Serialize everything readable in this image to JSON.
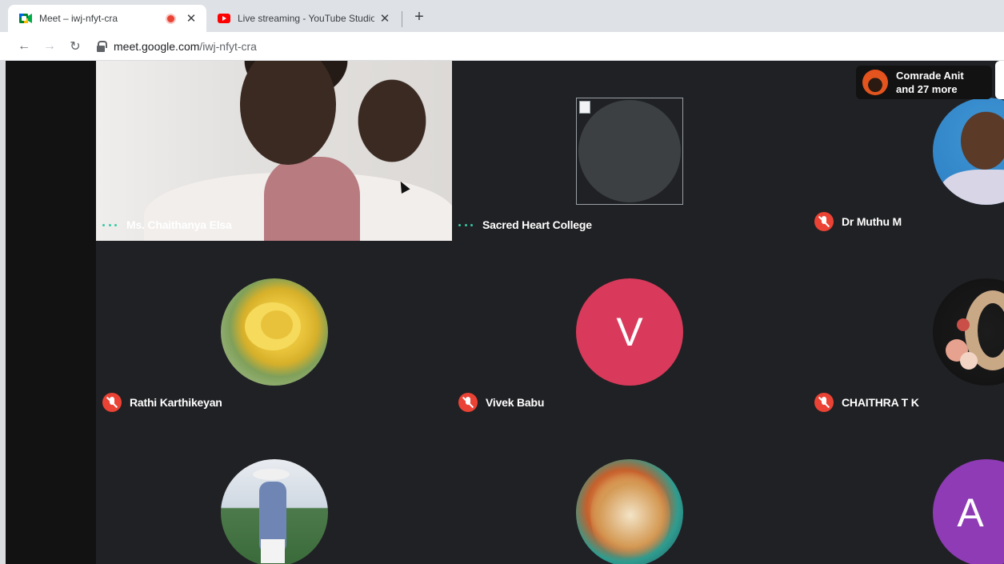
{
  "browser": {
    "tabs": [
      {
        "title": "Meet – iwj-nfyt-cra",
        "icon": "google-meet-icon",
        "recording": true,
        "active": true
      },
      {
        "title": "Live streaming - YouTube Studio",
        "icon": "youtube-icon",
        "active": false
      }
    ],
    "url_host": "meet.google.com",
    "url_path": "/iwj-nfyt-cra"
  },
  "meet": {
    "participants_overflow": {
      "line1": "Comrade Anit",
      "line2": "and 27 more"
    },
    "tiles": [
      {
        "name": "Ms. Chaithanya Elsa",
        "status": "speaking",
        "media": "video"
      },
      {
        "name": "Sacred Heart College",
        "status": "speaking",
        "media": "broken-image"
      },
      {
        "name": "Dr Muthu M",
        "status": "muted",
        "media": "photo-avatar"
      },
      {
        "name": "Rathi Karthikeyan",
        "status": "muted",
        "media": "photo-avatar"
      },
      {
        "name": "Vivek Babu",
        "status": "muted",
        "media": "letter-avatar",
        "letter": "V",
        "color": "#d93a5b"
      },
      {
        "name": "CHAITHRA T K",
        "status": "muted",
        "media": "photo-avatar"
      },
      {
        "name": "",
        "status": "",
        "media": "photo-avatar"
      },
      {
        "name": "",
        "status": "",
        "media": "photo-avatar"
      },
      {
        "name": "",
        "status": "",
        "media": "letter-avatar",
        "letter": "A",
        "color": "#8e3bb5"
      }
    ]
  },
  "colors": {
    "stage_bg": "#202124",
    "mic_off_red": "#ea4335",
    "speaking_teal": "#34c8a6"
  }
}
